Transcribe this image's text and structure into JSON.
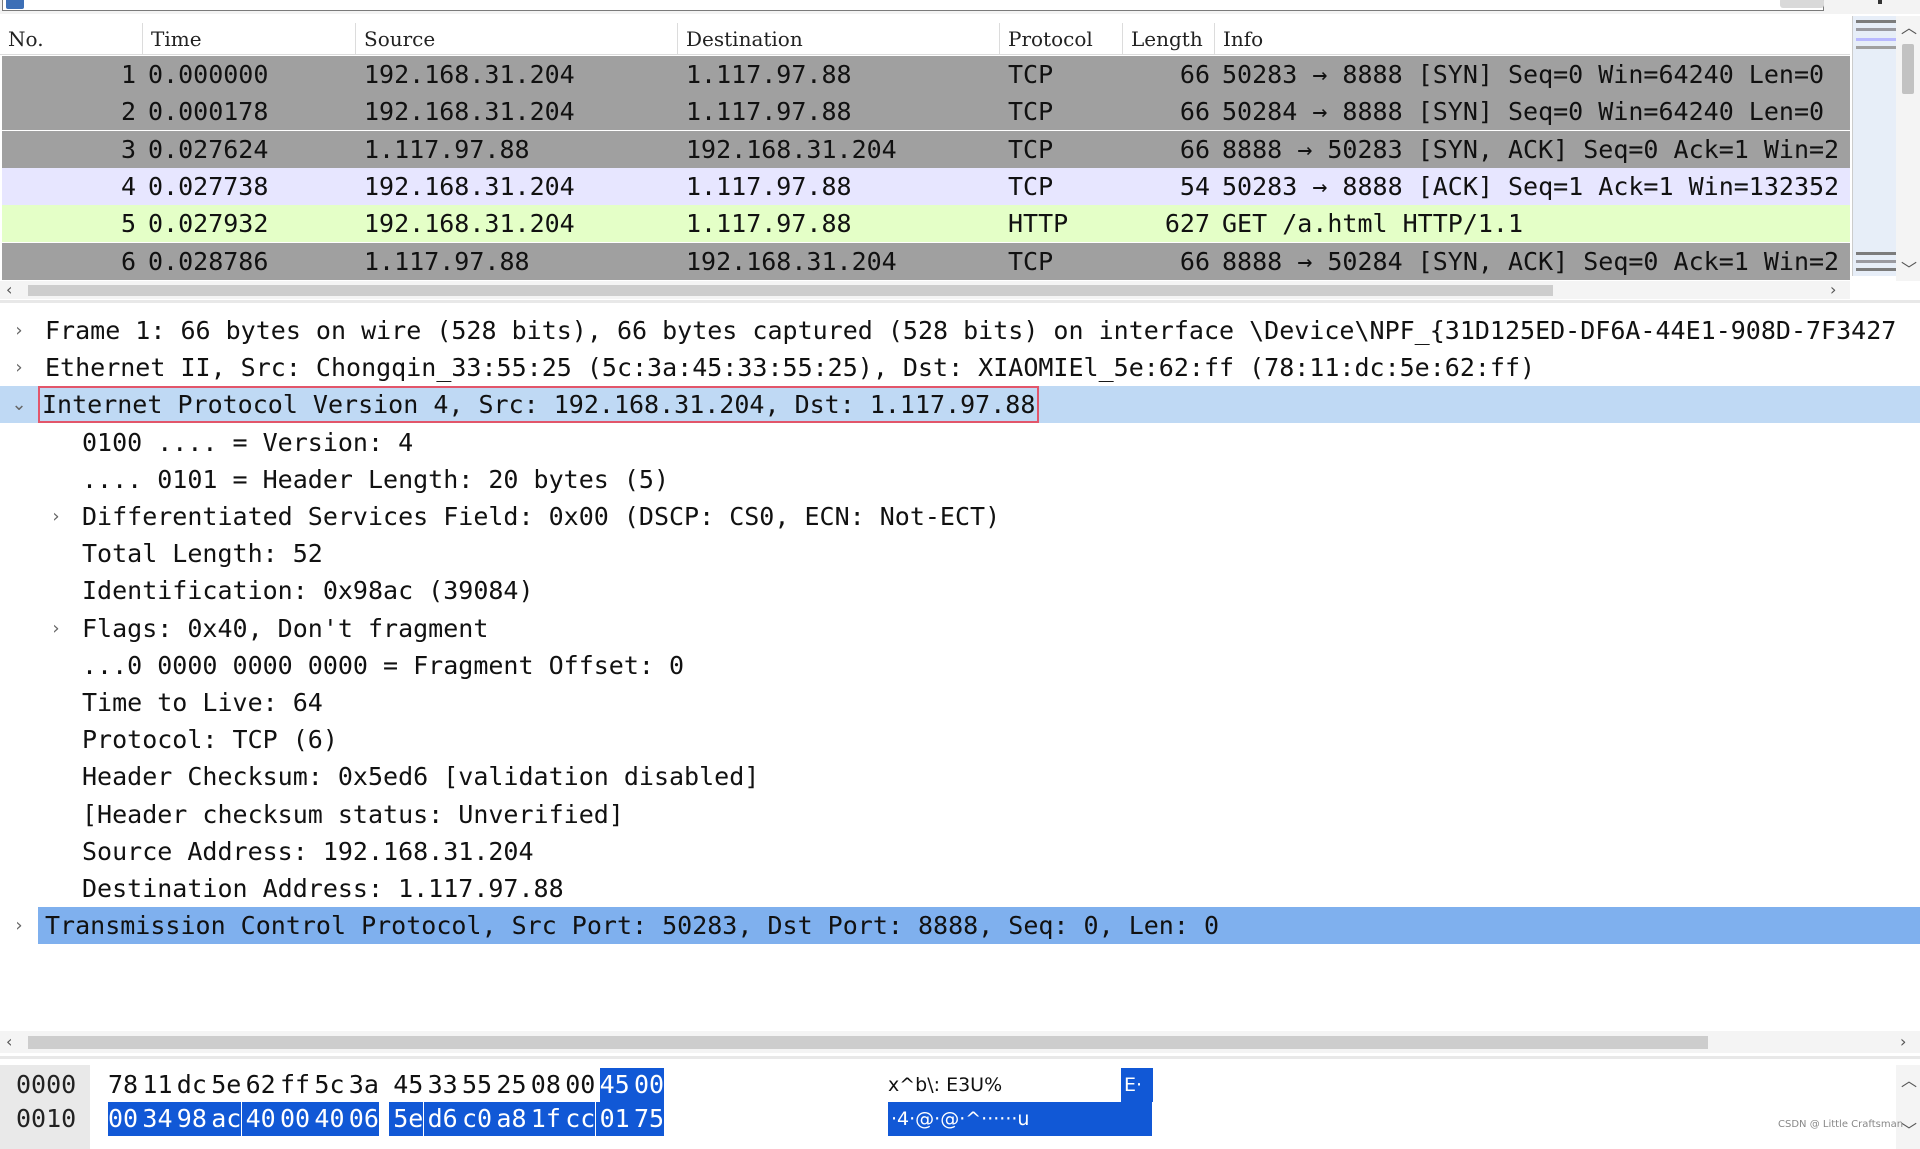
{
  "packet_list": {
    "columns": [
      "No.",
      "Time",
      "Source",
      "Destination",
      "Protocol",
      "Length",
      "Info"
    ],
    "rows": [
      {
        "no": "1",
        "time": "0.000000",
        "src": "192.168.31.204",
        "dst": "1.117.97.88",
        "proto": "TCP",
        "len": "66",
        "info": "50283 → 8888 [SYN] Seq=0 Win=64240 Len=0",
        "bg": "#a0a0a0"
      },
      {
        "no": "2",
        "time": "0.000178",
        "src": "192.168.31.204",
        "dst": "1.117.97.88",
        "proto": "TCP",
        "len": "66",
        "info": "50284 → 8888 [SYN] Seq=0 Win=64240 Len=0",
        "bg": "#a0a0a0"
      },
      {
        "no": "3",
        "time": "0.027624",
        "src": "1.117.97.88",
        "dst": "192.168.31.204",
        "proto": "TCP",
        "len": "66",
        "info": "8888 → 50283 [SYN, ACK] Seq=0 Ack=1 Win=2",
        "bg": "#a0a0a0"
      },
      {
        "no": "4",
        "time": "0.027738",
        "src": "192.168.31.204",
        "dst": "1.117.97.88",
        "proto": "TCP",
        "len": "54",
        "info": "50283 → 8888 [ACK] Seq=1 Ack=1 Win=132352",
        "bg": "#e7e6ff"
      },
      {
        "no": "5",
        "time": "0.027932",
        "src": "192.168.31.204",
        "dst": "1.117.97.88",
        "proto": "HTTP",
        "len": "627",
        "info": "GET /a.html HTTP/1.1",
        "bg": "#e4ffc7"
      },
      {
        "no": "6",
        "time": "0.028786",
        "src": "1.117.97.88",
        "dst": "192.168.31.204",
        "proto": "TCP",
        "len": "66",
        "info": "8888 → 50284 [SYN, ACK] Seq=0 Ack=1 Win=2",
        "bg": "#a0a0a0"
      }
    ]
  },
  "details": {
    "rows": [
      {
        "toggle": "›",
        "indent": 0,
        "text": "Frame 1: 66 bytes on wire (528 bits), 66 bytes captured (528 bits) on interface \\Device\\NPF_{31D125ED-DF6A-44E1-908D-7F3427"
      },
      {
        "toggle": "›",
        "indent": 0,
        "text": "Ethernet II, Src: Chongqin_33:55:25 (5c:3a:45:33:55:25), Dst: XIAOMIEl_5e:62:ff (78:11:dc:5e:62:ff)"
      },
      {
        "toggle": "⌄",
        "indent": 0,
        "text": "Internet Protocol Version 4, Src: 192.168.31.204, Dst: 1.117.97.88",
        "state": "sel"
      },
      {
        "toggle": "",
        "indent": 1,
        "text": "0100 .... = Version: 4"
      },
      {
        "toggle": "",
        "indent": 1,
        "text": ".... 0101 = Header Length: 20 bytes (5)"
      },
      {
        "toggle": "›",
        "indent": 1,
        "text": "Differentiated Services Field: 0x00 (DSCP: CS0, ECN: Not-ECT)"
      },
      {
        "toggle": "",
        "indent": 1,
        "text": "Total Length: 52"
      },
      {
        "toggle": "",
        "indent": 1,
        "text": "Identification: 0x98ac (39084)"
      },
      {
        "toggle": "›",
        "indent": 1,
        "text": "Flags: 0x40, Don't fragment"
      },
      {
        "toggle": "",
        "indent": 1,
        "text": "...0 0000 0000 0000 = Fragment Offset: 0"
      },
      {
        "toggle": "",
        "indent": 1,
        "text": "Time to Live: 64"
      },
      {
        "toggle": "",
        "indent": 1,
        "text": "Protocol: TCP (6)"
      },
      {
        "toggle": "",
        "indent": 1,
        "text": "Header Checksum: 0x5ed6 [validation disabled]"
      },
      {
        "toggle": "",
        "indent": 1,
        "text": "[Header checksum status: Unverified]"
      },
      {
        "toggle": "",
        "indent": 1,
        "text": "Source Address: 192.168.31.204"
      },
      {
        "toggle": "",
        "indent": 1,
        "text": "Destination Address: 1.117.97.88"
      },
      {
        "toggle": "›",
        "indent": 0,
        "text": "Transmission Control Protocol, Src Port: 50283, Dst Port: 8888, Seq: 0, Len: 0",
        "state": "hl"
      }
    ]
  },
  "bytes": {
    "rows": [
      {
        "offset": "0000",
        "hex": [
          "78",
          "11",
          "dc",
          "5e",
          "62",
          "ff",
          "5c",
          "3a",
          "45",
          "33",
          "55",
          "25",
          "08",
          "00",
          "45",
          "00"
        ],
        "sel": [
          false,
          false,
          false,
          false,
          false,
          false,
          false,
          false,
          false,
          false,
          false,
          false,
          false,
          false,
          true,
          true
        ],
        "ascii": "x^b\\: E3U%",
        "ascii_sel": "E·"
      },
      {
        "offset": "0010",
        "hex": [
          "00",
          "34",
          "98",
          "ac",
          "40",
          "00",
          "40",
          "06",
          "5e",
          "d6",
          "c0",
          "a8",
          "1f",
          "cc",
          "01",
          "75"
        ],
        "sel": [
          true,
          true,
          true,
          true,
          true,
          true,
          true,
          true,
          true,
          true,
          true,
          true,
          true,
          true,
          true,
          true
        ],
        "ascii": "",
        "ascii_sel": "·4·@·@·^······u"
      }
    ]
  },
  "watermark": "CSDN @ Little Craftsman",
  "colors": {
    "selection": "#1158d6",
    "tree_selected": "#bfd9f4",
    "tree_highlight": "#7fb0ee",
    "http_row": "#e4ffc7",
    "ack_row": "#e7e6ff",
    "tcp_row": "#a0a0a0"
  }
}
